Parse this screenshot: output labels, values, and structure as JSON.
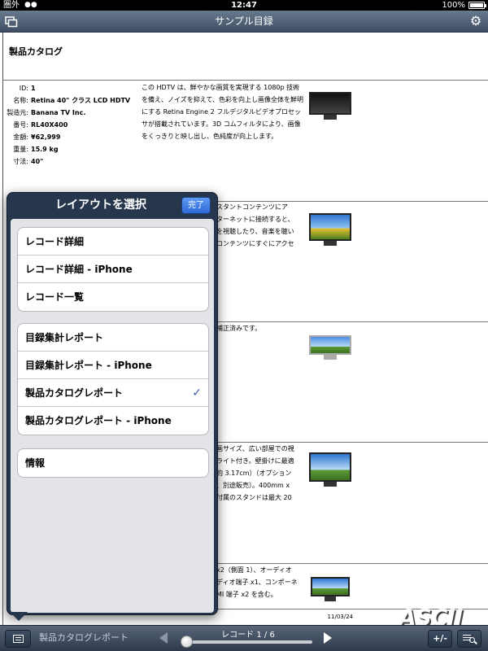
{
  "status_bar": {
    "carrier": "圏外",
    "time": "12:47",
    "battery_percent": "100%"
  },
  "nav": {
    "title": "サンプル目録"
  },
  "document": {
    "heading": "製品カタログ",
    "record": {
      "fields": [
        {
          "label": "ID:",
          "value": "1"
        },
        {
          "label": "名称:",
          "value": "Retina 40\" クラス LCD HDTV"
        },
        {
          "label": "製造元:",
          "value": "Banana TV Inc."
        },
        {
          "label": "番号:",
          "value": "RL40X400"
        },
        {
          "label": "金額:",
          "value": "¥62,999"
        },
        {
          "label": "重量:",
          "value": "15.9 kg"
        },
        {
          "label": "寸法:",
          "value": "40\""
        }
      ],
      "description": "この HDTV は、鮮やかな画質を実現する 1080p 技術を備え、ノイズを抑えて、色彩を向上し画像全体を鮮明にする Retina Engine 2 フルデジタルビデオプロセッサが搭載されています。3D コムフィルタにより、画像をくっきりと映し出し、色純度が向上します。"
    },
    "fragments": {
      "f2": [
        "スタントコンテンツにア",
        "ターネットに接続すると、",
        "を視聴したり、音楽を聴い",
        "コンテンツにすぐにアクセ"
      ],
      "f3": [
        "補正済みです。"
      ],
      "f4": [
        "画サイズ、広い部屋での視",
        "ライト付き。壁掛けに最適",
        "約 3.17cm）（オプション",
        "、別途販売）。400mm x",
        "付属のスタンドは最大 20"
      ],
      "f5": [
        "x2（側面 1）、オーディオ",
        "ディオ端子 x1、コンポーネ",
        "MI 端子 x2 を含む。"
      ]
    },
    "date": "11/03/24"
  },
  "popover": {
    "title": "レイアウトを選択",
    "done_label": "完了",
    "group1": [
      "レコード詳細",
      "レコード詳細 - iPhone",
      "レコード一覧"
    ],
    "group2": [
      "目録集計レポート",
      "目録集計レポート - iPhone",
      "製品カタログレポート",
      "製品カタログレポート - iPhone"
    ],
    "group3": [
      "情報"
    ],
    "selected": "製品カタログレポート",
    "check_glyph": "✓"
  },
  "toolbar": {
    "layout_name": "製品カタログレポート",
    "record_label": "レコード 1 / 6",
    "record_position": 1,
    "record_total": 6,
    "plus_minus_label": "+/-",
    "accent_color": "#3a7be0"
  },
  "watermark": "ASCII",
  "icons": [
    "window-switch-icon",
    "gear-icon",
    "list-icon",
    "prev-arrow-icon",
    "next-arrow-icon",
    "search-list-icon",
    "checkmark-icon"
  ]
}
